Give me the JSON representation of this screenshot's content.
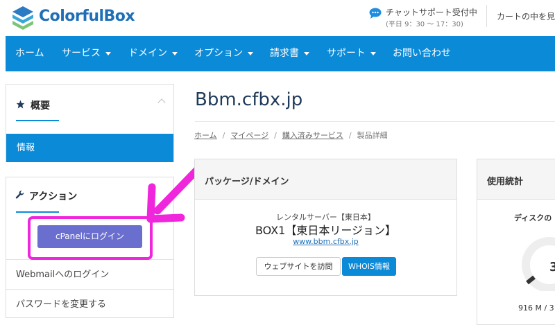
{
  "header": {
    "brand": "ColorfulBox",
    "support_title": "チャットサポート受付中",
    "support_hours": "(平日 9：30 〜 17：30)",
    "cart_label": "カートの中を見",
    "brand_color": "#1f6fb7"
  },
  "nav": {
    "items": [
      {
        "label": "ホーム",
        "dropdown": false
      },
      {
        "label": "サービス",
        "dropdown": true
      },
      {
        "label": "ドメイン",
        "dropdown": true
      },
      {
        "label": "オプション",
        "dropdown": true
      },
      {
        "label": "請求書",
        "dropdown": true
      },
      {
        "label": "サポート",
        "dropdown": true
      },
      {
        "label": "お問い合わせ",
        "dropdown": false
      }
    ],
    "bg_color": "#0b8ad8"
  },
  "sidebar": {
    "overview": {
      "title": "概要",
      "icon": "star-icon",
      "active_item": "情報"
    },
    "actions": {
      "title": "アクション",
      "icon": "wrench-icon",
      "cpanel_button": "cPanelにログイン",
      "links": [
        "Webmailへのログイン",
        "パスワードを変更する"
      ]
    }
  },
  "main": {
    "title": "Bbm.cfbx.jp",
    "breadcrumb": [
      "ホーム",
      "マイページ",
      "購入済みサービス",
      "製品詳細"
    ],
    "package_card": {
      "heading": "パッケージ/ドメイン",
      "product_type": "レンタルサーバー【東日本】",
      "product_name": "BOX1【東日本リージョン】",
      "domain": "www.bbm.cfbx.jp",
      "visit_button": "ウェブサイトを訪問",
      "whois_button": "WHOIS情報"
    },
    "stats_card": {
      "heading": "使用統計",
      "disk_label": "ディスクの",
      "gauge_value": "3",
      "usage_text": "916 M / 3"
    }
  },
  "annotation": {
    "highlight_color": "#f026dd"
  }
}
